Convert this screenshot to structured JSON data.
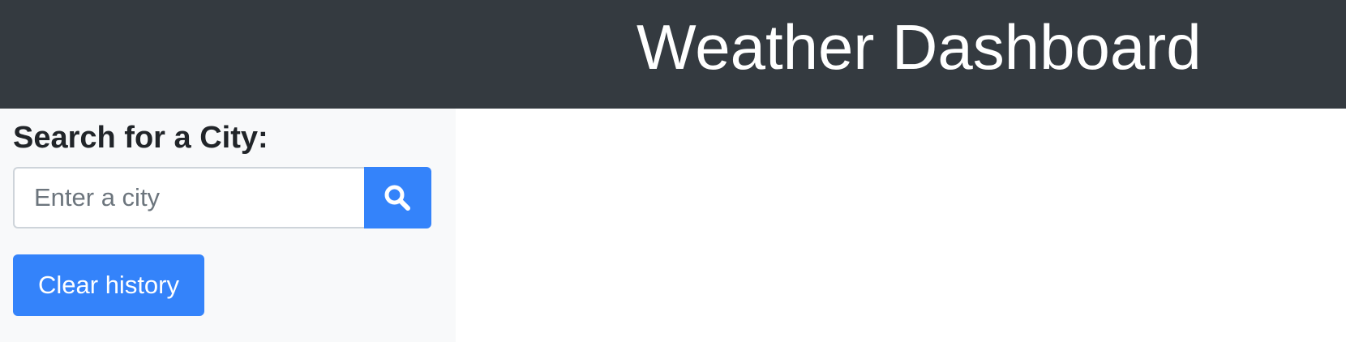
{
  "header": {
    "title": "Weather Dashboard"
  },
  "sidebar": {
    "search_label": "Search for a City:",
    "search_input": {
      "value": "",
      "placeholder": "Enter a city"
    },
    "search_button_icon": "search-icon",
    "clear_history_label": "Clear history"
  },
  "colors": {
    "header_bg": "#343a40",
    "sidebar_bg": "#f8f9fa",
    "primary": "#3483fa",
    "text_dark": "#212529",
    "placeholder": "#6c757d"
  }
}
